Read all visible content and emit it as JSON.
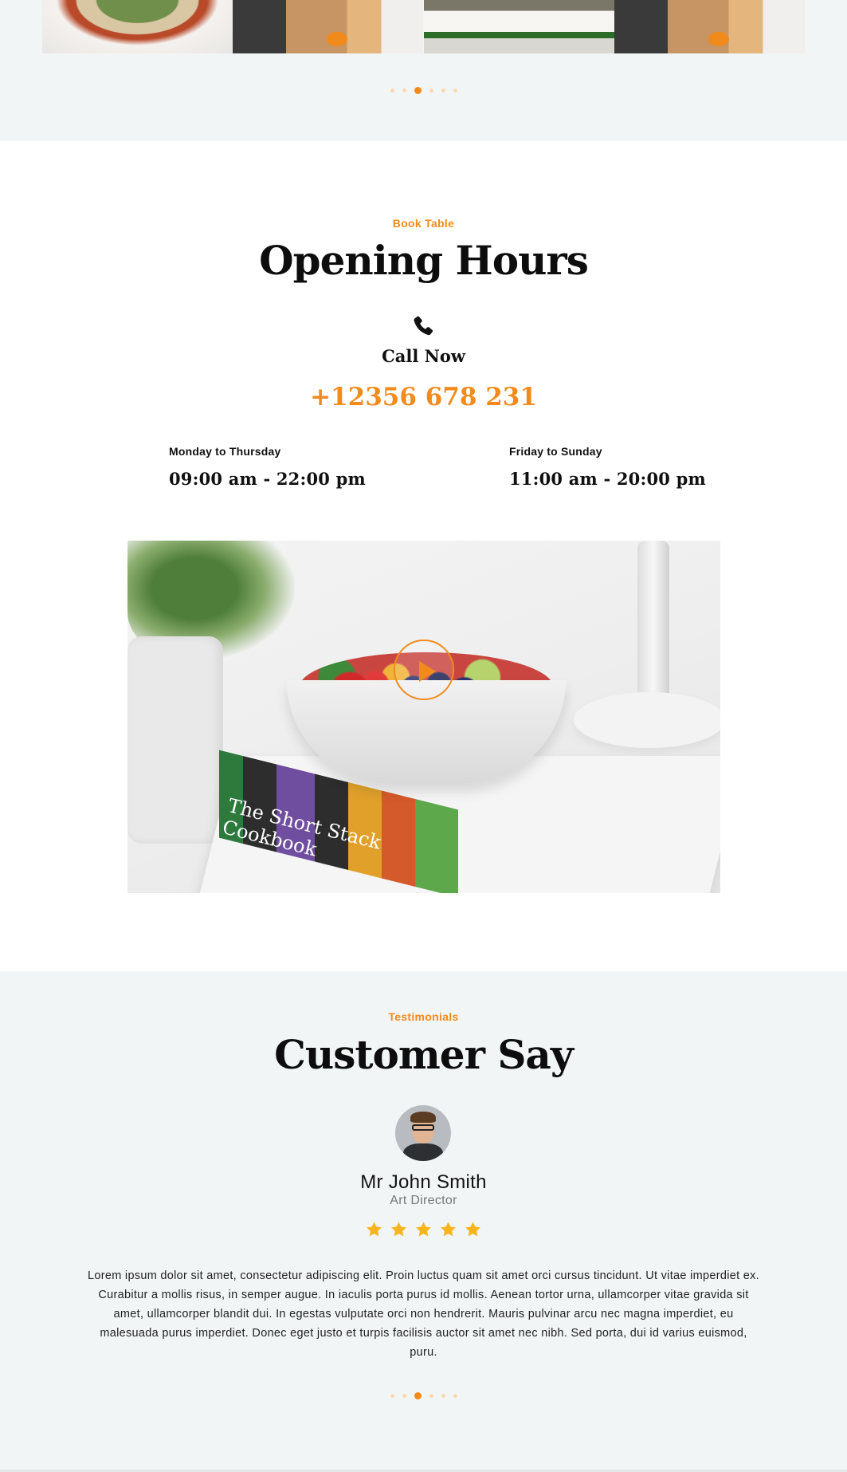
{
  "gallery": {
    "images": [
      "salad-plate",
      "bread-toast-egg",
      "egg-sandwich",
      "bread-toast-egg"
    ],
    "dots": [
      false,
      false,
      true,
      false,
      false,
      false
    ]
  },
  "hours": {
    "eyebrow": "Book Table",
    "title": "Opening Hours",
    "call_label": "Call Now",
    "phone": "+12356 678 231",
    "schedule": [
      {
        "days": "Monday to Thursday",
        "time": "09:00 am - 22:00 pm"
      },
      {
        "days": "Friday to Sunday",
        "time": "11:00 am - 20:00 pm"
      }
    ],
    "video": {
      "book_text": "The Short Stack Cookbook"
    }
  },
  "testimonials": {
    "eyebrow": "Testimonials",
    "title": "Customer Say",
    "name": "Mr John Smith",
    "role": "Art Director",
    "rating": 5,
    "quote": "Lorem ipsum dolor sit amet, consectetur adipiscing elit. Proin luctus quam sit amet orci cursus tincidunt. Ut vitae imperdiet ex. Curabitur a mollis risus, in semper augue. In iaculis porta purus id mollis. Aenean tortor urna, ullamcorper vitae gravida sit amet, ullamcorper blandit dui. In egestas vulputate orci non hendrerit. Mauris pulvinar arcu nec magna imperdiet, eu malesuada purus imperdiet. Donec eget justo et turpis facilisis auctor sit amet nec nibh. Sed porta, dui id varius euismod, puru.",
    "dots": [
      false,
      false,
      true,
      false,
      false,
      false
    ]
  },
  "colors": {
    "accent": "#f28b1c",
    "star": "#f7b51b",
    "section_bg": "#f2f5f6"
  }
}
